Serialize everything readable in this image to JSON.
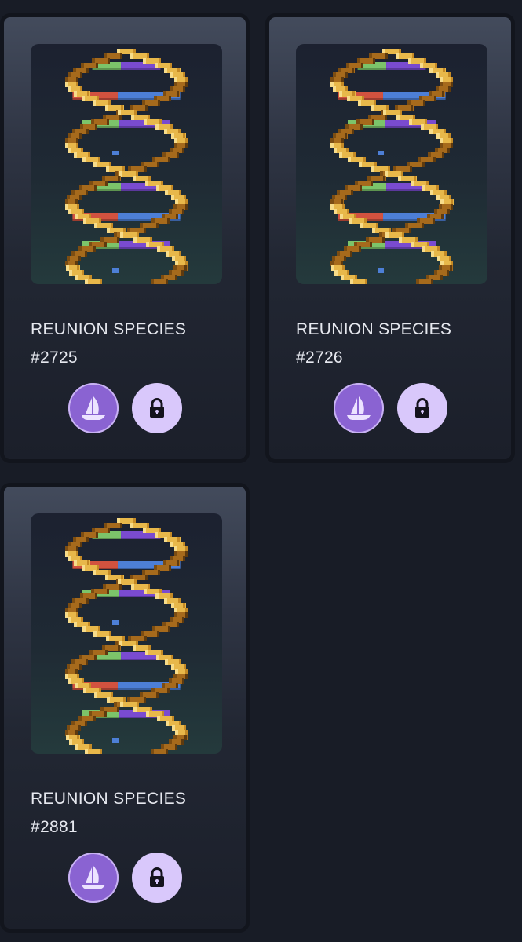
{
  "cards": [
    {
      "title": "REUNION SPECIES",
      "number": "#2725",
      "image_icon": "dna-helix-icon",
      "marketplace_icon": "opensea-boat-icon",
      "lock_icon": "lock-icon"
    },
    {
      "title": "REUNION SPECIES",
      "number": "#2726",
      "image_icon": "dna-helix-icon",
      "marketplace_icon": "opensea-boat-icon",
      "lock_icon": "lock-icon"
    },
    {
      "title": "REUNION SPECIES",
      "number": "#2881",
      "image_icon": "dna-helix-icon",
      "marketplace_icon": "opensea-boat-icon",
      "lock_icon": "lock-icon"
    }
  ],
  "colors": {
    "page_background": "#181c26",
    "helix_gold": "#e8b84a",
    "helix_shadow": "#a66a1c",
    "rung_green": "#7cc46a",
    "rung_purple": "#7a4bd0",
    "rung_red": "#d2523f",
    "rung_blue": "#4d7fd6",
    "marketplace_button": "#8a63d2",
    "lock_button": "#d9c8fb"
  }
}
